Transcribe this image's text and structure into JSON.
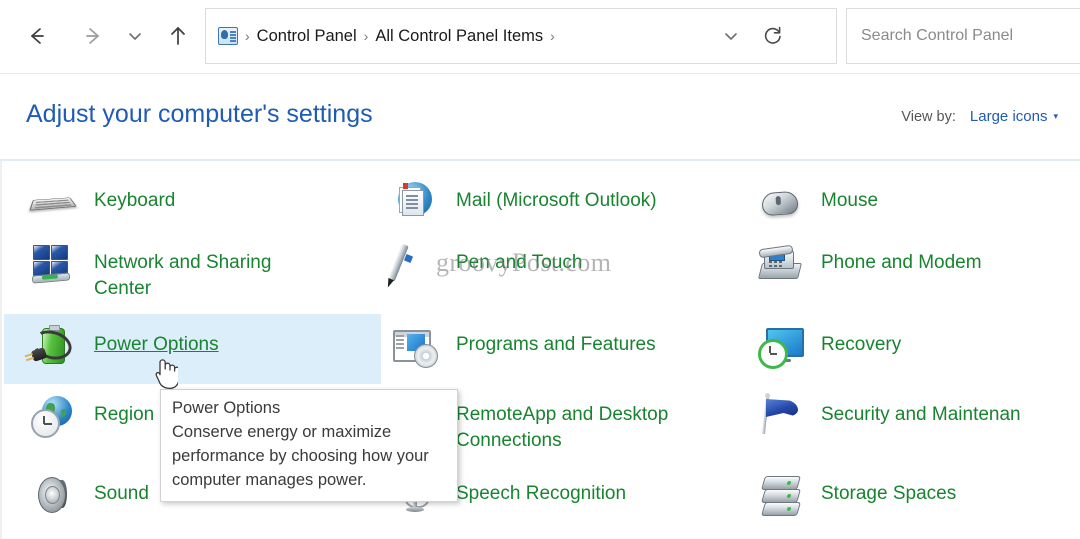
{
  "window": {
    "title": "All Control Panel Items"
  },
  "toolbar": {
    "back_label": "Back",
    "forward_label": "Forward",
    "recent_label": "Recent locations",
    "up_label": "Up one level",
    "breadcrumb_icon": "control-panel-icon",
    "breadcrumbs": [
      "Control Panel",
      "All Control Panel Items"
    ],
    "separator": "›",
    "dropdown_icon": "chevron-down-icon",
    "refresh_icon": "refresh-icon",
    "refresh_label": "Refresh"
  },
  "search": {
    "value": "",
    "placeholder": "Search Control Panel"
  },
  "header": {
    "title": "Adjust your computer's settings",
    "view_by_label": "View by:",
    "view_by_value": "Large icons",
    "view_by_caret": "▾"
  },
  "colors": {
    "title_blue": "#1f5bb5",
    "item_green": "#18842f",
    "highlight": "#ddeefb",
    "divider": "#e3ebf7"
  },
  "items": [
    {
      "label": "Keyboard",
      "icon": "keyboard-icon",
      "col": 1,
      "row": 1
    },
    {
      "label": "Mail (Microsoft Outlook)",
      "icon": "mail-icon",
      "col": 2,
      "row": 1
    },
    {
      "label": "Mouse",
      "icon": "mouse-icon",
      "col": 3,
      "row": 1
    },
    {
      "label": "Network and Sharing\nCenter",
      "icon": "network-sharing-icon",
      "col": 1,
      "row": 2
    },
    {
      "label": "Pen and Touch",
      "icon": "pen-touch-icon",
      "col": 2,
      "row": 2
    },
    {
      "label": "Phone and Modem",
      "icon": "phone-modem-icon",
      "col": 3,
      "row": 2
    },
    {
      "label": "Power Options",
      "icon": "power-options-icon",
      "col": 1,
      "row": 3,
      "hovered": true
    },
    {
      "label": "Programs and Features",
      "icon": "programs-features-icon",
      "col": 2,
      "row": 3
    },
    {
      "label": "Recovery",
      "icon": "recovery-icon",
      "col": 3,
      "row": 3
    },
    {
      "label": "Region",
      "icon": "region-icon",
      "col": 1,
      "row": 4
    },
    {
      "label": "RemoteApp and Desktop\nConnections",
      "icon": "remoteapp-icon",
      "col": 2,
      "row": 4
    },
    {
      "label": "Security and Maintenan",
      "icon": "security-maintenance-icon",
      "col": 3,
      "row": 4
    },
    {
      "label": "Sound",
      "icon": "sound-icon",
      "col": 1,
      "row": 5
    },
    {
      "label": "Speech Recognition",
      "icon": "speech-recognition-icon",
      "col": 2,
      "row": 5
    },
    {
      "label": "Storage Spaces",
      "icon": "storage-spaces-icon",
      "col": 3,
      "row": 5
    }
  ],
  "tooltip": {
    "title": "Power Options",
    "body": "Conserve energy or maximize performance by choosing how your computer manages power."
  },
  "watermark": {
    "text": "groovyPost.com"
  }
}
